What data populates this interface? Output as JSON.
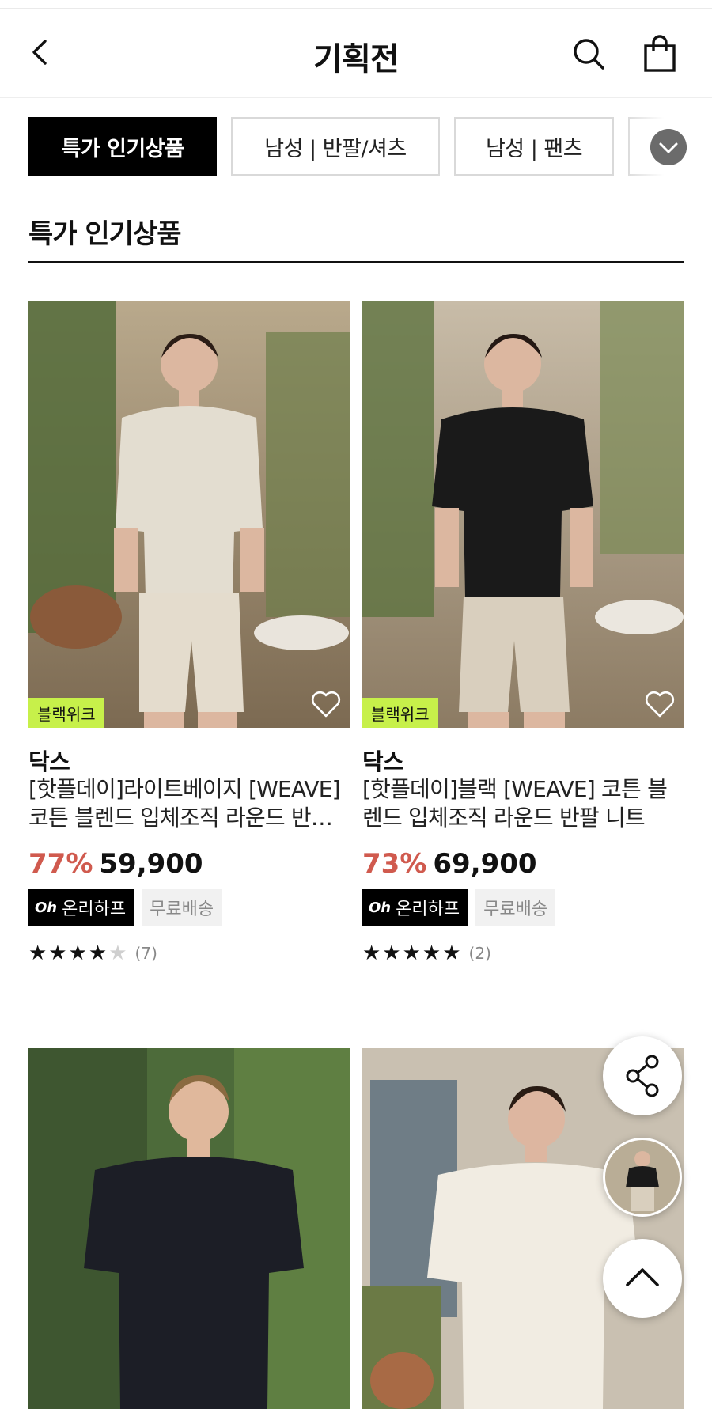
{
  "header": {
    "title": "기획전",
    "back_icon": "chevron-left-icon",
    "search_icon": "search-icon",
    "cart_icon": "shopping-bag-icon"
  },
  "tabs": [
    {
      "label": "특가 인기상품",
      "active": true
    },
    {
      "label": "남성 | 반팔/셔츠",
      "active": false
    },
    {
      "label": "남성 | 팬츠",
      "active": false
    }
  ],
  "section": {
    "title": "특가 인기상품"
  },
  "products": [
    {
      "badge": "블랙위크",
      "brand": "닥스",
      "name": "[핫플데이]라이트베이지 [WEAVE] 코튼 블렌드 입체조직 라운드 반팔 니트",
      "discount": "77%",
      "price": "59,900",
      "deal_tag": "온리하프",
      "deal_logo": "Oh",
      "shipping_tag": "무료배송",
      "rating": 4.5,
      "review_count": "(7)",
      "shirt_color": "#e3ddd0"
    },
    {
      "badge": "블랙위크",
      "brand": "닥스",
      "name": "[핫플데이]블랙 [WEAVE] 코튼 블렌드 입체조직 라운드 반팔 니트",
      "discount": "73%",
      "price": "69,900",
      "deal_tag": "온리하프",
      "deal_logo": "Oh",
      "shipping_tag": "무료배송",
      "rating": 5,
      "review_count": "(2)",
      "shirt_color": "#1a1a1a"
    },
    {
      "shirt_color": "#1c1e26"
    },
    {
      "shirt_color": "#f1ece2"
    }
  ],
  "floating": {
    "share_icon": "share-icon",
    "top_icon": "chevron-up-icon"
  }
}
